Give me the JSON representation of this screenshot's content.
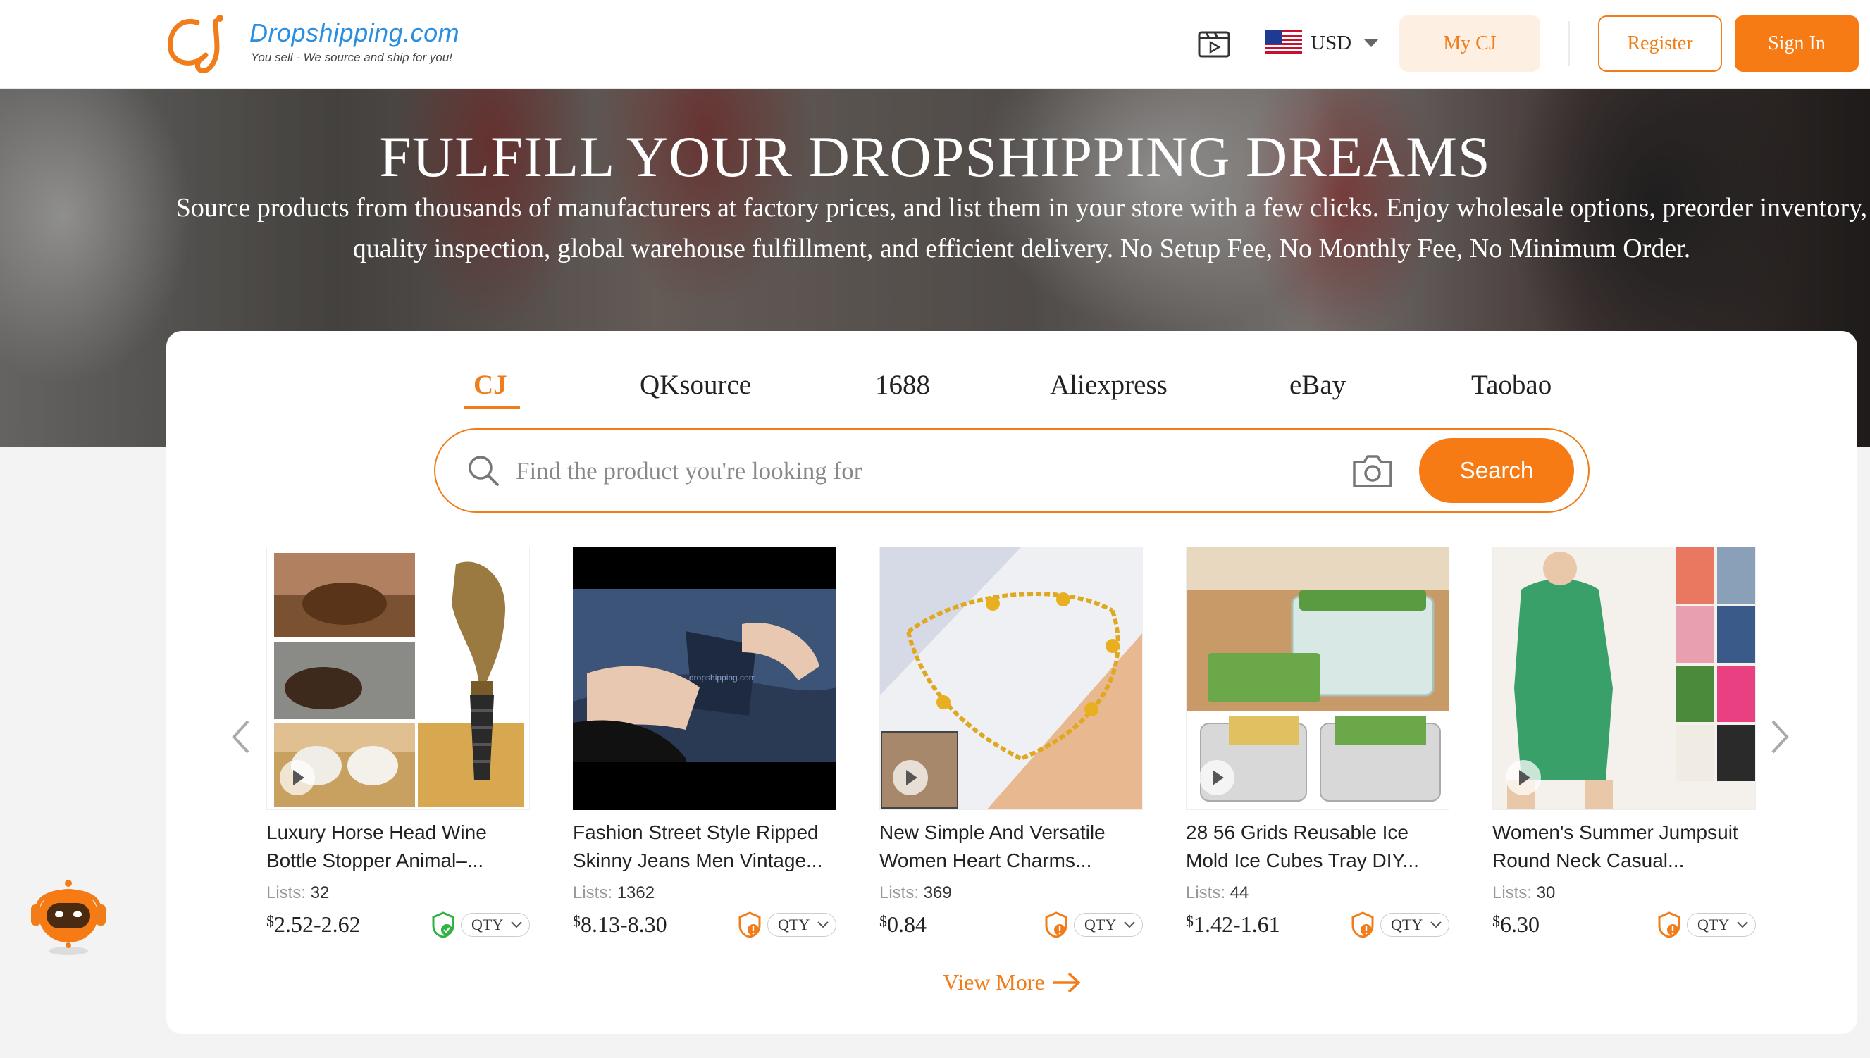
{
  "header": {
    "logo_name": "Dropshipping.com",
    "logo_tagline": "You sell - We source and ship for you!",
    "currency": "USD",
    "my_cj": "My CJ",
    "register": "Register",
    "sign_in": "Sign In"
  },
  "hero": {
    "title": "FULFILL YOUR DROPSHIPPING DREAMS",
    "subtitle": "Source products from thousands of manufacturers at factory prices, and list them in your store with a few clicks. Enjoy wholesale options, preorder inventory, quality inspection, global warehouse fulfillment, and efficient delivery. No Setup Fee, No Monthly Fee, No Minimum Order."
  },
  "tabs": [
    "CJ",
    "QKsource",
    "1688",
    "Aliexpress",
    "eBay",
    "Taobao"
  ],
  "active_tab": "CJ",
  "search": {
    "placeholder": "Find the product you're looking for",
    "button": "Search"
  },
  "products": [
    {
      "name_line1": "Luxury Horse Head Wine",
      "name_line2": "Bottle Stopper Animal–...",
      "lists_label": "Lists:",
      "lists": "32",
      "currency": "$",
      "price": "2.52-2.62",
      "qty": "QTY",
      "badge": "shield-check-green"
    },
    {
      "name_line1": "Fashion Street Style Ripped",
      "name_line2": "Skinny Jeans Men Vintage...",
      "lists_label": "Lists:",
      "lists": "1362",
      "currency": "$",
      "price": "8.13-8.30",
      "qty": "QTY",
      "badge": "shield-orange"
    },
    {
      "name_line1": "New Simple And Versatile",
      "name_line2": "Women Heart Charms...",
      "lists_label": "Lists:",
      "lists": "369",
      "currency": "$",
      "price": "0.84",
      "qty": "QTY",
      "badge": "shield-orange"
    },
    {
      "name_line1": "28 56 Grids Reusable Ice",
      "name_line2": "Mold Ice Cubes Tray DIY...",
      "lists_label": "Lists:",
      "lists": "44",
      "currency": "$",
      "price": "1.42-1.61",
      "qty": "QTY",
      "badge": "shield-orange"
    },
    {
      "name_line1": "Women's Summer Jumpsuit",
      "name_line2": "Round Neck Casual...",
      "lists_label": "Lists:",
      "lists": "30",
      "currency": "$",
      "price": "6.30",
      "qty": "QTY",
      "badge": "shield-orange"
    }
  ],
  "view_more": "View More",
  "colors": {
    "accent": "#f07d1a",
    "accent_light": "#fdf0e3",
    "brand_blue": "#2a8fe0"
  }
}
